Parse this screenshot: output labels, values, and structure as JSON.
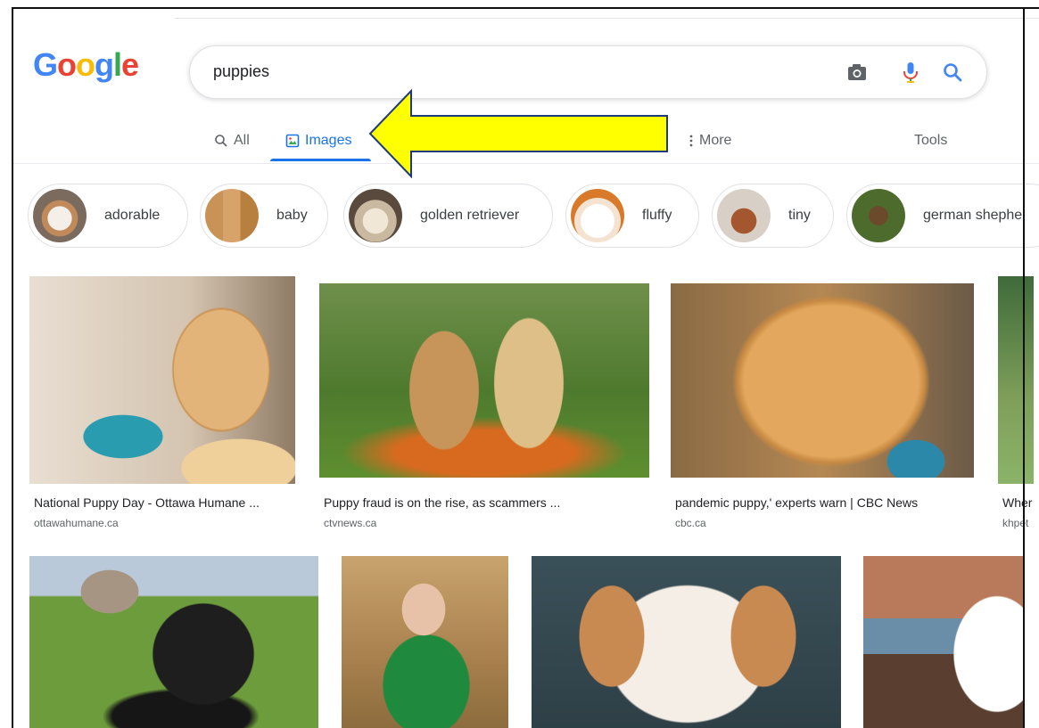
{
  "logo": {
    "letters": [
      "G",
      "o",
      "o",
      "g",
      "l",
      "e"
    ]
  },
  "search": {
    "query": "puppies",
    "camera_icon": "camera-icon",
    "mic_icon": "microphone-icon",
    "search_icon": "search-icon"
  },
  "tabs": [
    {
      "label": "All",
      "icon": "search-icon",
      "active": false
    },
    {
      "label": "Images",
      "icon": "image-icon",
      "active": true
    },
    {
      "label": "More",
      "icon": "more-vertical-icon",
      "active": false
    }
  ],
  "tools_label": "Tools",
  "chips": [
    {
      "label": "adorable"
    },
    {
      "label": "baby"
    },
    {
      "label": "golden retriever"
    },
    {
      "label": "fluffy"
    },
    {
      "label": "tiny"
    },
    {
      "label": "german shephe"
    }
  ],
  "results_row1": [
    {
      "title": "National Puppy Day - Ottawa Humane ...",
      "source": "ottawahumane.ca"
    },
    {
      "title": "Puppy fraud is on the rise, as scammers ...",
      "source": "ctvnews.ca"
    },
    {
      "title": "pandemic puppy,' experts warn | CBC News",
      "source": "cbc.ca"
    },
    {
      "title": "Wher",
      "source": "khpet"
    }
  ],
  "colors": {
    "accent": "#1a73e8",
    "arrow_fill": "#ffff00",
    "arrow_stroke": "#1f3a7a"
  }
}
